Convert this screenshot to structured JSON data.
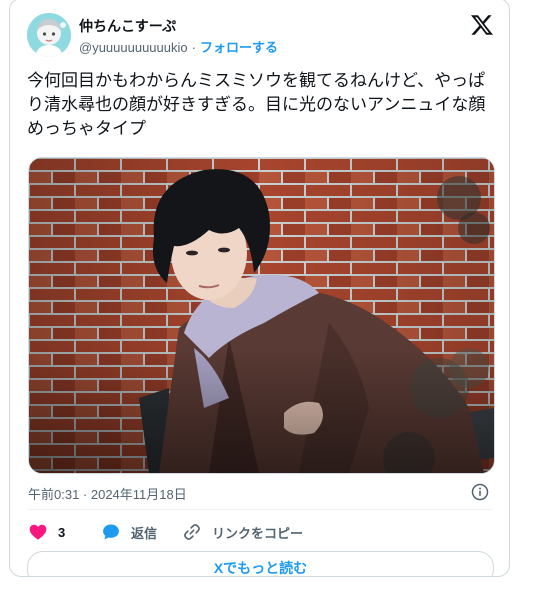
{
  "author": {
    "display_name": "仲ちんこすーぷ",
    "handle": "@yuuuuuuuuuukio",
    "separator": "·",
    "follow_label": "フォローする"
  },
  "tweet": {
    "text": "今何回目かもわからんミスミソウを観てるねんけど、やっぱり清水尋也の顔が好きすぎる。目に光のないアンニュイな顔めっちゃタイプ",
    "timestamp": "午前0:31 · 2024年11月18日"
  },
  "actions": {
    "like_count": "3",
    "reply_label": "返信",
    "copy_link_label": "リンクをコピー"
  },
  "read_more_label": "Xでもっと読む",
  "colors": {
    "accent": "#1d9bf0",
    "like": "#f91880",
    "text": "#0f1419",
    "muted": "#536471",
    "border": "#cfd9de"
  },
  "icons": {
    "logo": "x-logo-icon",
    "info": "info-icon",
    "like": "heart-icon",
    "reply": "speech-bubble-icon",
    "copy_link": "link-icon"
  }
}
